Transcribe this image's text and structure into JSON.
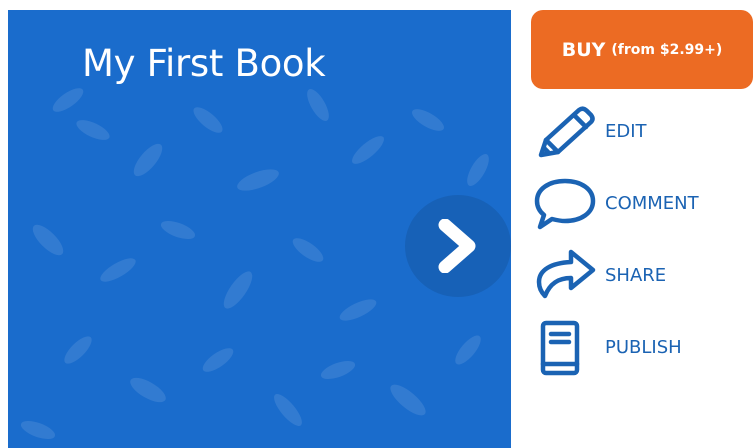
{
  "book": {
    "title": "My First Book",
    "cover_color": "#1a6ccc"
  },
  "navigation": {
    "next_icon": "chevron-right-icon"
  },
  "buy": {
    "label": "BUY",
    "price": "(from $2.99+)",
    "color": "#ec6b23"
  },
  "actions": [
    {
      "label": "EDIT",
      "icon": "pencil-icon"
    },
    {
      "label": "COMMENT",
      "icon": "speech-bubble-icon"
    },
    {
      "label": "SHARE",
      "icon": "share-arrow-icon"
    },
    {
      "label": "PUBLISH",
      "icon": "book-icon"
    }
  ],
  "accent_color": "#1b63b3"
}
